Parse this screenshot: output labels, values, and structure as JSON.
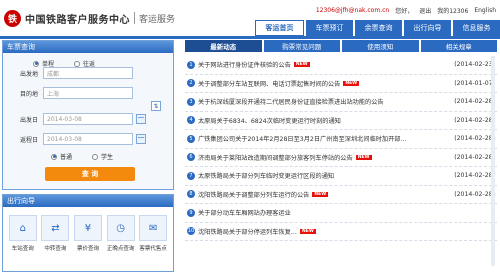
{
  "header": {
    "logo_glyph": "铁",
    "site_name": "中国铁路客户服务中心",
    "section": "客运服务",
    "account": "12306@jfh@nak.com.cn",
    "welcome": "您好，",
    "logout": "退出",
    "hotline": "我的12306",
    "lang": "English"
  },
  "nav": [
    {
      "label": "客运首页",
      "active": true
    },
    {
      "label": "车票预订"
    },
    {
      "label": "余票查询"
    },
    {
      "label": "出行向导"
    },
    {
      "label": "信息服务"
    }
  ],
  "booking": {
    "title": "车票查询",
    "trip_single": "单程",
    "trip_round": "往返",
    "from_label": "出发地",
    "from_value": "成都",
    "to_label": "目的地",
    "to_value": "上海",
    "depart_label": "出发日",
    "depart_value": "2014-03-08",
    "return_label": "返程日",
    "return_value": "2014-03-08",
    "type_normal": "普通",
    "type_student": "学生",
    "query_button": "查 询",
    "swap_glyph": "⇅"
  },
  "guide": {
    "title": "出行向导",
    "items": [
      {
        "label": "车站查询",
        "icon": "station-icon",
        "glyph": "⌂"
      },
      {
        "label": "中转查询",
        "icon": "transfer-icon",
        "glyph": "⇄"
      },
      {
        "label": "票价查询",
        "icon": "price-icon",
        "glyph": "¥"
      },
      {
        "label": "正晚点查询",
        "icon": "clock-icon",
        "glyph": "◷"
      },
      {
        "label": "客票代售点",
        "icon": "agency-icon",
        "glyph": "✉"
      }
    ]
  },
  "news": {
    "tabs": [
      {
        "label": "最新动态",
        "active": true
      },
      {
        "label": "购票常见问题"
      },
      {
        "label": "使用须知"
      },
      {
        "label": "相关规章"
      }
    ],
    "items": [
      {
        "n": "1",
        "text": "关于网站进行身份证件核验的公告",
        "new": true,
        "date": "(2014-02-23)"
      },
      {
        "n": "2",
        "text": "关于调整部分车站互联网、电话订票起售时间的公告",
        "new": true,
        "date": "(2014-01-07)"
      },
      {
        "n": "3",
        "text": "关于杭深线厦深段开通持二代居民身份证直接检票进出站功能的公告",
        "new": false,
        "date": "(2014-02-28)"
      },
      {
        "n": "4",
        "text": "太原局关于6834、6824次临时变更运行时刻的通知",
        "new": false,
        "date": "(2014-02-28)"
      },
      {
        "n": "5",
        "text": "广铁集团公司关于2014年2月28日至3月2日广州南至深圳北间临时加开部…",
        "new": false,
        "date": "(2014-02-28)"
      },
      {
        "n": "6",
        "text": "济南局关于莱阳站改造期间调整部分旅客列车停站的公告",
        "new": true,
        "date": "(2014-02-28)"
      },
      {
        "n": "7",
        "text": "太原铁路局关于部分列车临时变更运行区段的通知",
        "new": false,
        "date": "(2014-02-28)"
      },
      {
        "n": "8",
        "text": "沈阳铁路局关于调整部分列车运行的公告",
        "new": true,
        "date": "(2014-02-28)"
      },
      {
        "n": "9",
        "text": "关于部分动车车厢网站办理客运业",
        "new": false,
        "date": ""
      },
      {
        "n": "10",
        "text": "沈阳铁路局关于部分停运列车恢复…",
        "new": true,
        "date": ""
      }
    ],
    "new_badge": "NEW"
  }
}
